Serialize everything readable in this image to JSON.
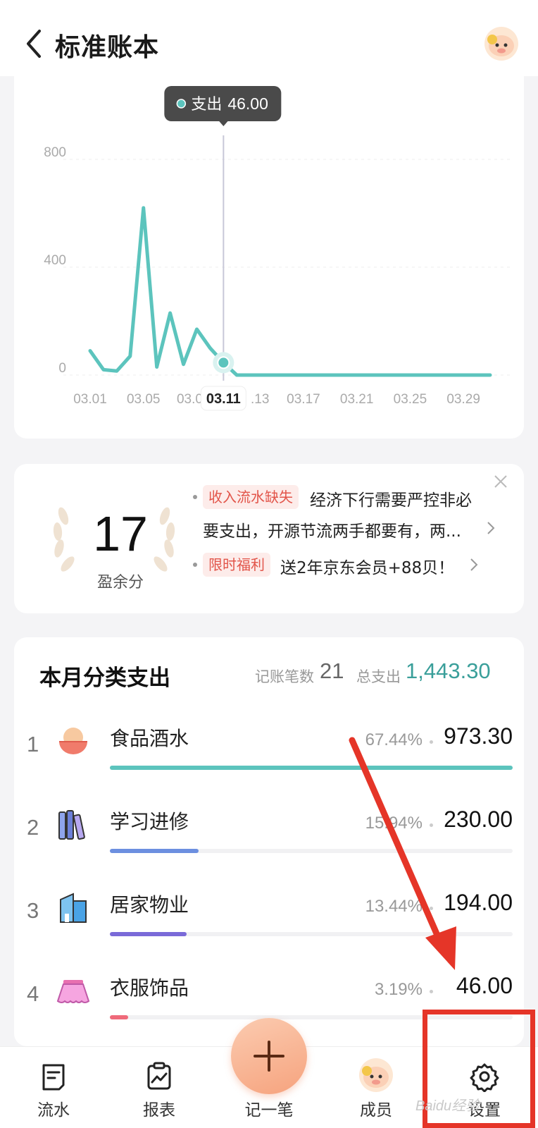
{
  "header": {
    "title": "标准账本"
  },
  "chart": {
    "tooltip": {
      "label": "支出",
      "value": "46.00"
    },
    "selected_tick": "03.11",
    "ytick_labels": [
      "800",
      "400",
      "0"
    ],
    "xtick_labels": [
      "03.01",
      "03.05",
      "03.0",
      "03.11",
      ".13",
      "03.17",
      "03.21",
      "03.25",
      "03.29"
    ],
    "line_color": "#5cc4bd"
  },
  "chart_data": {
    "type": "line",
    "series": [
      {
        "name": "支出",
        "x": [
          "03.01",
          "03.02",
          "03.03",
          "03.04",
          "03.05",
          "03.06",
          "03.07",
          "03.08",
          "03.09",
          "03.10",
          "03.11",
          "03.12",
          "03.13",
          "03.14",
          "03.15",
          "03.16",
          "03.17",
          "03.18",
          "03.19",
          "03.20",
          "03.21",
          "03.22",
          "03.23",
          "03.24",
          "03.25",
          "03.26",
          "03.27",
          "03.28",
          "03.29",
          "03.30",
          "03.31"
        ],
        "values": [
          90,
          20,
          15,
          70,
          620,
          30,
          230,
          40,
          170,
          100,
          46,
          0,
          0,
          0,
          0,
          0,
          0,
          0,
          0,
          0,
          0,
          0,
          0,
          0,
          0,
          0,
          0,
          0,
          0,
          0,
          0
        ]
      }
    ],
    "yticks": [
      0,
      400,
      800
    ],
    "ylim": [
      0,
      800
    ],
    "grid": true
  },
  "score": {
    "value": "17",
    "label": "盈余分",
    "notices": [
      {
        "tag": "收入流水缺失",
        "line1": "经济下行需要严控非必",
        "line2": "要支出，开源节流两手都要有，两..."
      },
      {
        "tag": "限时福利",
        "line1": "送2年京东会员+88贝！"
      }
    ]
  },
  "category": {
    "title": "本月分类支出",
    "count_label": "记账笔数",
    "count_value": "21",
    "total_label": "总支出",
    "total_value": "1,443.30",
    "total_color": "#3a9f9a",
    "items": [
      {
        "rank": "1",
        "name": "食品酒水",
        "percent": "67.44%",
        "amount": "973.30",
        "share": 0.6744,
        "icon": "food-bowl-icon",
        "color": "#5cc4bd"
      },
      {
        "rank": "2",
        "name": "学习进修",
        "percent": "15.94%",
        "amount": "230.00",
        "share": 0.1594,
        "icon": "books-icon",
        "color": "#6c8fe0"
      },
      {
        "rank": "3",
        "name": "居家物业",
        "percent": "13.44%",
        "amount": "194.00",
        "share": 0.1344,
        "icon": "building-icon",
        "color": "#7a6ad8"
      },
      {
        "rank": "4",
        "name": "衣服饰品",
        "percent": "3.19%",
        "amount": "46.00",
        "share": 0.0319,
        "icon": "skirt-icon",
        "color": "#ef6a7a"
      }
    ]
  },
  "nav": {
    "items": [
      {
        "label": "流水",
        "icon": "ledger-icon"
      },
      {
        "label": "报表",
        "icon": "report-icon"
      },
      {
        "label": "记一笔",
        "icon": "plus-icon"
      },
      {
        "label": "成员",
        "icon": "member-avatar-icon"
      },
      {
        "label": "设置",
        "icon": "gear-icon"
      }
    ]
  },
  "watermark": "Baidu经验"
}
